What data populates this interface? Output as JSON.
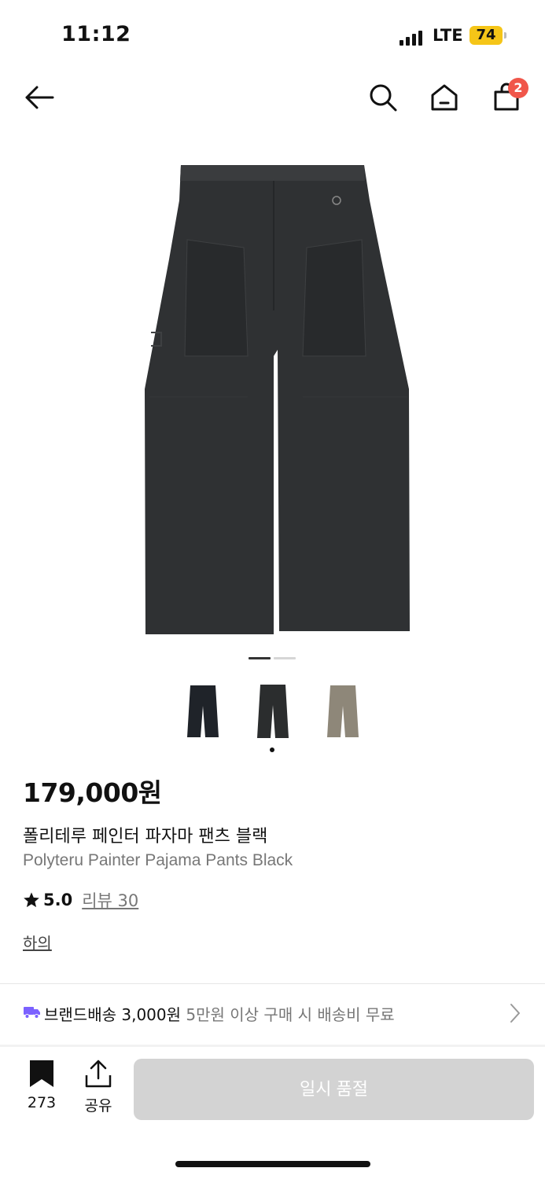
{
  "status_bar": {
    "time": "11:12",
    "network": "LTE",
    "battery": "74",
    "battery_color": "#f5c518"
  },
  "header": {
    "back_icon": "arrow-left-icon",
    "search_icon": "search-icon",
    "home_icon": "home-icon",
    "cart_icon": "shopping-bag-icon",
    "cart_count": "2",
    "badge_color": "#f0564a"
  },
  "carousel": {
    "total": 2,
    "active": 1
  },
  "color_options": [
    {
      "name": "navy",
      "color": "#1f2329",
      "selected": false
    },
    {
      "name": "black",
      "color": "#2b2d2e",
      "selected": true
    },
    {
      "name": "khaki",
      "color": "#8e8779",
      "selected": false
    }
  ],
  "product": {
    "price": "179,000원",
    "title_ko": "폴리테루 페인터 파자마 팬츠 블랙",
    "title_en": "Polyteru Painter Pajama Pants Black",
    "rating": "5.0",
    "review_label": "리뷰 30",
    "category": "하의"
  },
  "shipping": {
    "label": "브랜드배송 3,000원",
    "note": "5만원 이상 구매 시 배송비 무료",
    "icon_color": "#7b61ff"
  },
  "bottom_bar": {
    "bookmark_count": "273",
    "share_label": "공유",
    "cta_label": "일시 품절"
  }
}
